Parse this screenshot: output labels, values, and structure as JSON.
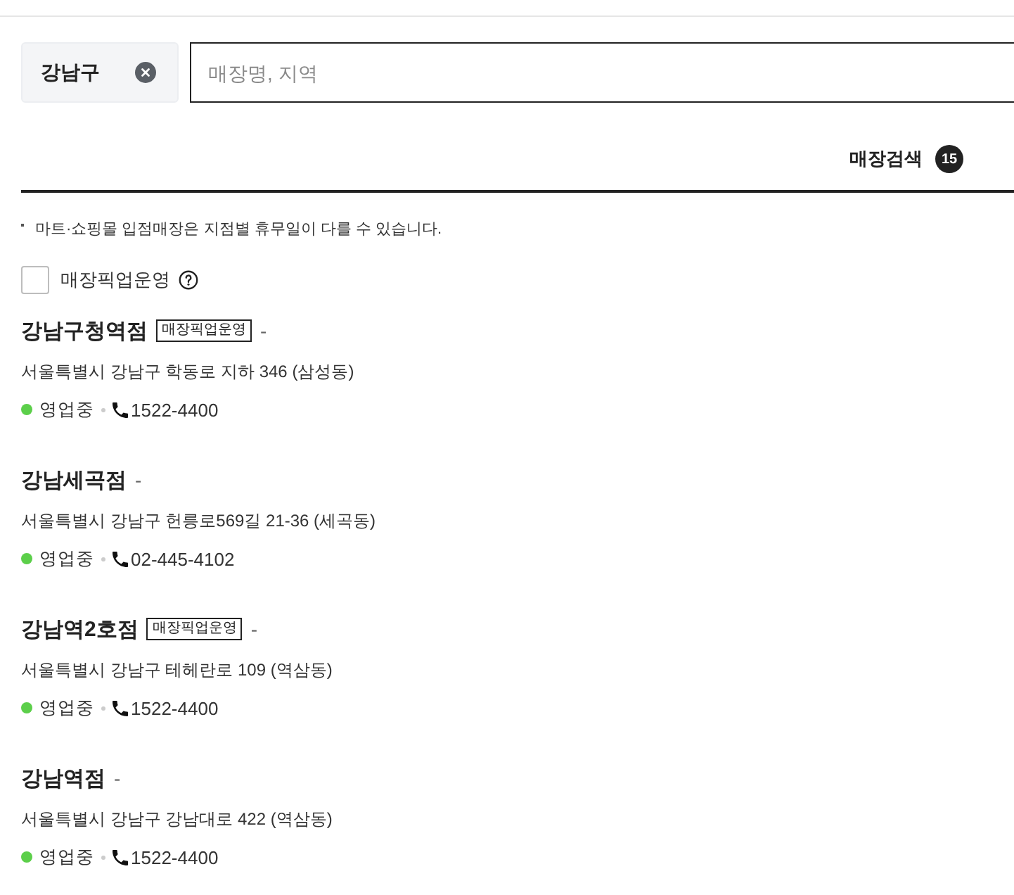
{
  "filter": {
    "chip_label": "강남구"
  },
  "search": {
    "placeholder": "매장명, 지역"
  },
  "results_header": {
    "title": "매장검색",
    "count": "15"
  },
  "notice": "마트·쇼핑몰 입점매장은 지점별 휴무일이 다를 수 있습니다.",
  "pickup_filter": {
    "label": "매장픽업운영",
    "checked": false
  },
  "stores": [
    {
      "name": "강남구청역점",
      "badge": "매장픽업운영",
      "name_suffix": "-",
      "address": "서울특별시 강남구 학동로 지하 346 (삼성동)",
      "status": "영업중",
      "open": true,
      "phone": "1522-4400"
    },
    {
      "name": "강남세곡점",
      "name_suffix": "-",
      "address": "서울특별시 강남구 헌릉로569길 21-36 (세곡동)",
      "status": "영업중",
      "open": true,
      "phone": "02-445-4102"
    },
    {
      "name": "강남역2호점",
      "badge": "매장픽업운영",
      "name_suffix": "-",
      "address": "서울특별시 강남구 테헤란로 109 (역삼동)",
      "status": "영업중",
      "open": true,
      "phone": "1522-4400"
    },
    {
      "name": "강남역점",
      "name_suffix": "-",
      "address": "서울특별시 강남구 강남대로 422 (역삼동)",
      "status": "영업중",
      "open": true,
      "phone": "1522-4400"
    }
  ]
}
